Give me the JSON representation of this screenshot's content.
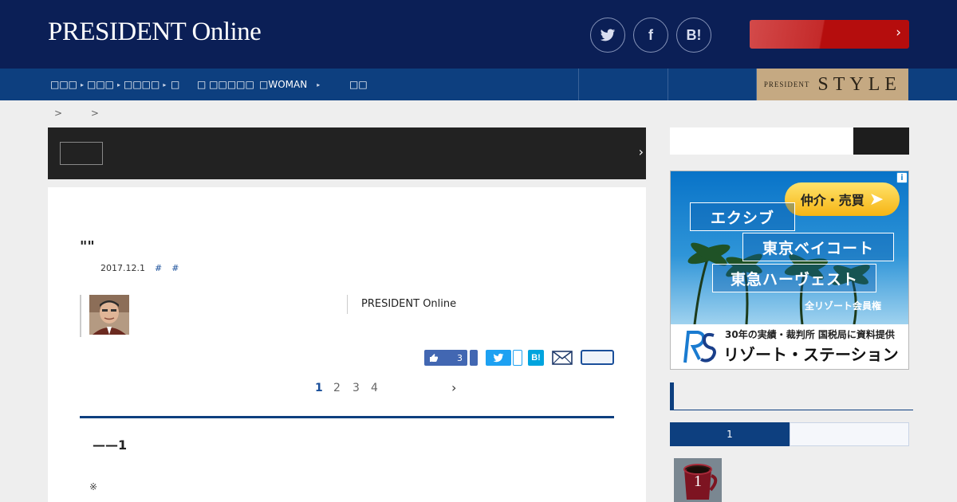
{
  "header": {
    "logo": "PRESIDENT Online",
    "social": [
      {
        "label": "",
        "icon": "twitter-icon"
      },
      {
        "label": "f",
        "icon": "facebook-icon"
      },
      {
        "label": "B!",
        "icon": "hatena-bookmark-icon"
      }
    ],
    "cta_label": "",
    "cta_chevron": "›"
  },
  "nav": {
    "items": [
      {
        "label": "□□□",
        "caret": "▸"
      },
      {
        "label": "□□□",
        "caret": "▸"
      },
      {
        "label": "□□□□",
        "caret": "▸"
      },
      {
        "label": "□",
        "caret": ""
      },
      {
        "label": "□ □□□□□",
        "caret": ""
      },
      {
        "label": "□WOMAN",
        "caret": "▸"
      },
      {
        "label": "□□",
        "caret": ""
      }
    ],
    "style_small": "PRESIDENT",
    "style_big": "STYLE"
  },
  "breadcrumb": [
    ">",
    ">"
  ],
  "topic_bar": {
    "chevron": "›"
  },
  "article": {
    "title": "\"\"",
    "date": "2017.12.1",
    "tags": [
      "#",
      "#"
    ],
    "publisher": "PRESIDENT Online",
    "like_count": "3",
    "pagination": [
      "1",
      "2",
      "3",
      "4"
    ],
    "current_page": "1",
    "next": "›",
    "subheading": "——1",
    "note": "※"
  },
  "sidebar": {
    "search_placeholder": "",
    "ad": {
      "info": "i",
      "pill": "仲介・売買",
      "pill_arrow": "➤",
      "lines": [
        "エクシブ",
        "東京ベイコート",
        "東急ハーヴェスト"
      ],
      "members": "全リゾート会員権",
      "record": "30年の実績・裁判所 国税局に資料提供",
      "company": "リゾート・ステーション",
      "logo": "RS"
    },
    "ranking_tab_active": "1",
    "ranking_first": "1"
  }
}
